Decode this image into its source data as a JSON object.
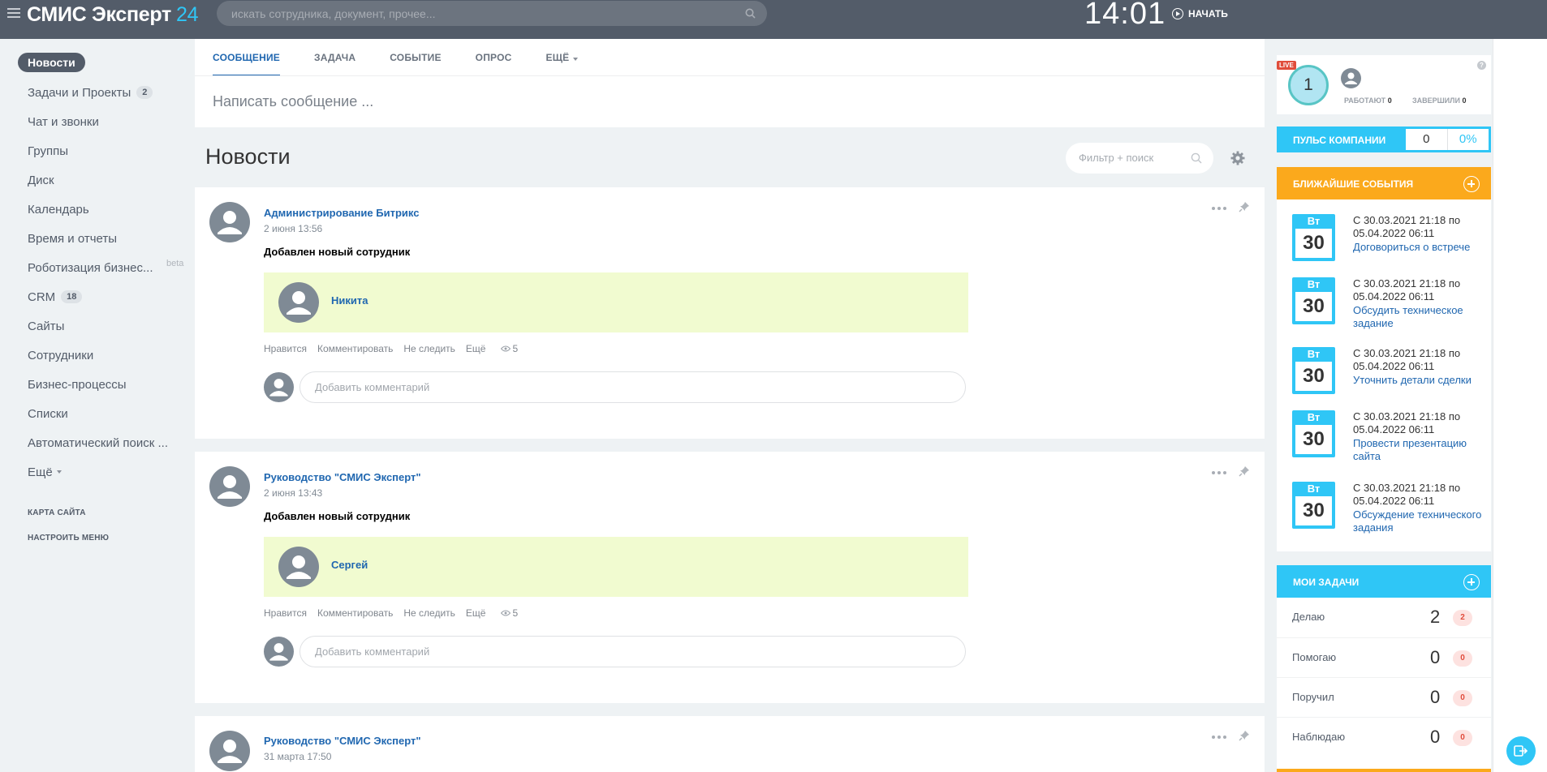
{
  "header": {
    "logo_text": "СМИС Эксперт",
    "logo_num": "24",
    "search_placeholder": "искать сотрудника, документ, прочее...",
    "clock": "14:01",
    "start_label": "НАЧАТЬ"
  },
  "sidebar": {
    "items": [
      {
        "label": "Новости"
      },
      {
        "label": "Задачи и Проекты",
        "counter": "2"
      },
      {
        "label": "Чат и звонки"
      },
      {
        "label": "Группы"
      },
      {
        "label": "Диск"
      },
      {
        "label": "Календарь"
      },
      {
        "label": "Время и отчеты"
      },
      {
        "label": "Роботизация бизнес...",
        "badge": "beta"
      },
      {
        "label": "CRM",
        "counter": "18"
      },
      {
        "label": "Сайты"
      },
      {
        "label": "Сотрудники"
      },
      {
        "label": "Бизнес-процессы"
      },
      {
        "label": "Списки"
      },
      {
        "label": "Автоматический поиск ..."
      },
      {
        "label": "Ещё"
      }
    ],
    "sitemap": "КАРТА САЙТА",
    "configure": "НАСТРОИТЬ МЕНЮ"
  },
  "composer": {
    "tabs": [
      "СООБЩЕНИЕ",
      "ЗАДАЧА",
      "СОБЫТИЕ",
      "ОПРОС",
      "ЕЩЁ"
    ],
    "placeholder": "Написать сообщение ..."
  },
  "feed": {
    "title": "Новости",
    "filter_placeholder": "Фильтр + поиск",
    "posts": [
      {
        "author": "Администрирование Битрикс",
        "date": "2 июня 13:56",
        "title": "Добавлен новый сотрудник",
        "employee": "Никита",
        "actions": [
          "Нравится",
          "Комментировать",
          "Не следить",
          "Ещё"
        ],
        "views": "5",
        "comment_placeholder": "Добавить комментарий"
      },
      {
        "author": "Руководство \"СМИС Эксперт\"",
        "date": "2 июня 13:43",
        "title": "Добавлен новый сотрудник",
        "employee": "Сергей",
        "actions": [
          "Нравится",
          "Комментировать",
          "Не следить",
          "Ещё"
        ],
        "views": "5",
        "comment_placeholder": "Добавить комментарий"
      },
      {
        "author": "Руководство \"СМИС Эксперт\"",
        "date": "31 марта 17:50"
      }
    ]
  },
  "live": {
    "badge": "LIVE",
    "count": "1",
    "working_label": "РАБОТАЮТ",
    "working_value": "0",
    "finished_label": "ЗАВЕРШИЛИ",
    "finished_value": "0",
    "help": "?"
  },
  "pulse": {
    "label": "ПУЛЬС КОМПАНИИ",
    "value": "0",
    "percent": "0%"
  },
  "events": {
    "title": "БЛИЖАЙШИЕ СОБЫТИЯ",
    "items": [
      {
        "weekday": "Вт",
        "day": "30",
        "time": "С 30.03.2021 21:18 по 05.04.2022 06:11",
        "title": "Договориться о встрече"
      },
      {
        "weekday": "Вт",
        "day": "30",
        "time": "С 30.03.2021 21:18 по 05.04.2022 06:11",
        "title": "Обсудить техническое задание"
      },
      {
        "weekday": "Вт",
        "day": "30",
        "time": "С 30.03.2021 21:18 по 05.04.2022 06:11",
        "title": "Уточнить детали сделки"
      },
      {
        "weekday": "Вт",
        "day": "30",
        "time": "С 30.03.2021 21:18 по 05.04.2022 06:11",
        "title": "Провести презентацию сайта"
      },
      {
        "weekday": "Вт",
        "day": "30",
        "time": "С 30.03.2021 21:18 по 05.04.2022 06:11",
        "title": "Обсуждение технического задания"
      }
    ]
  },
  "tasks": {
    "title": "МОИ ЗАДАЧИ",
    "rows": [
      {
        "label": "Делаю",
        "count": "2",
        "badge": "2"
      },
      {
        "label": "Помогаю",
        "count": "0",
        "badge": "0"
      },
      {
        "label": "Поручил",
        "count": "0",
        "badge": "0"
      },
      {
        "label": "Наблюдаю",
        "count": "0",
        "badge": "0"
      }
    ]
  },
  "colors": {
    "header_bg": "#535c69",
    "accent_blue": "#2fc6f6",
    "link_blue": "#2067b0",
    "events_orange": "#fba91c",
    "post_box_green": "#f1fbd0",
    "badge_red": "#e14b3b"
  }
}
